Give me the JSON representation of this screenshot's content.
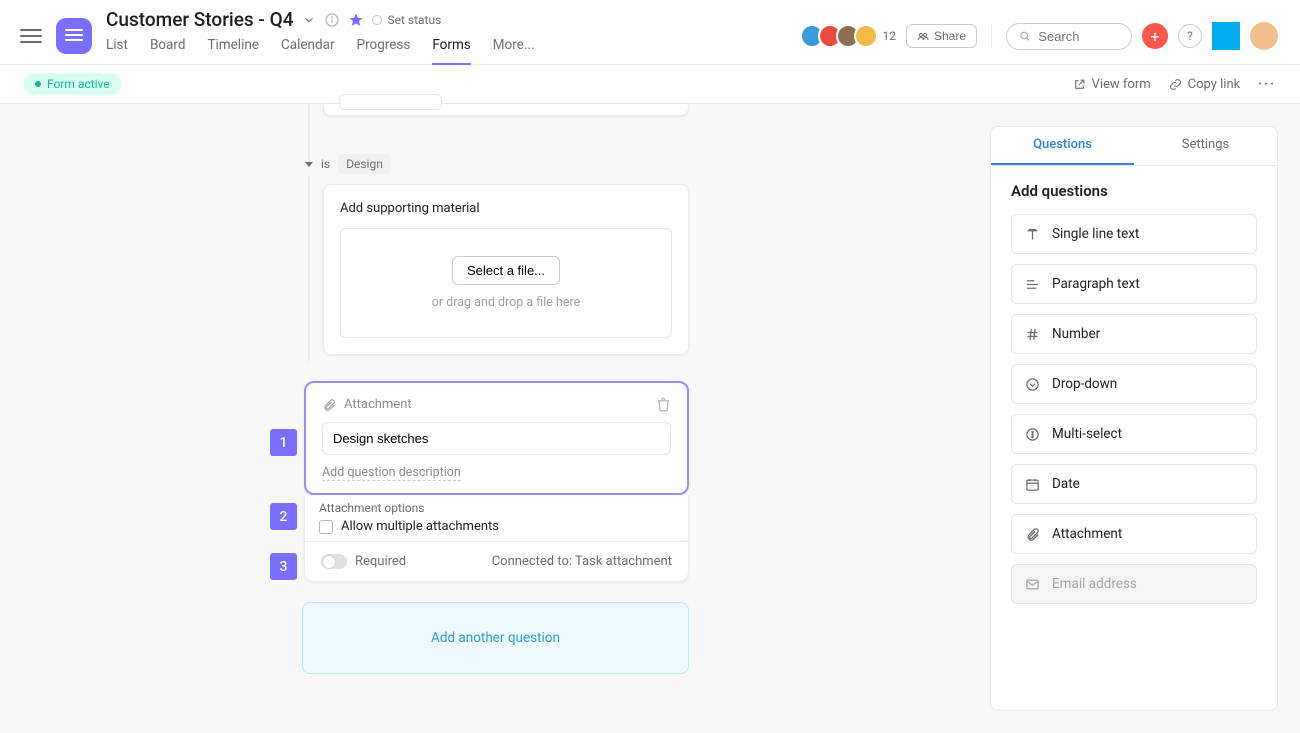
{
  "header": {
    "title": "Customer Stories - Q4",
    "set_status": "Set status",
    "tabs": [
      "List",
      "Board",
      "Timeline",
      "Calendar",
      "Progress",
      "Forms",
      "More..."
    ],
    "active_tab_index": 5,
    "avatar_overflow": "12",
    "share": "Share",
    "search_placeholder": "Search"
  },
  "subbar": {
    "form_badge": "Form active",
    "view_form": "View form",
    "copy_link": "Copy link"
  },
  "branch": {
    "is": "is",
    "value": "Design"
  },
  "supporting": {
    "title": "Add supporting material",
    "select_file": "Select a file...",
    "hint": "or drag and drop a file here"
  },
  "steps": [
    "1",
    "2",
    "3"
  ],
  "question": {
    "type_label": "Attachment",
    "title_value": "Design sketches",
    "add_description": "Add question description",
    "options_title": "Attachment options",
    "allow_multiple": "Allow multiple attachments",
    "required": "Required",
    "connected": "Connected to: Task attachment"
  },
  "add_another": "Add another question",
  "sidepanel": {
    "tabs": [
      "Questions",
      "Settings"
    ],
    "active_tab_index": 0,
    "title": "Add questions",
    "types": [
      {
        "label": "Single line text",
        "icon": "text"
      },
      {
        "label": "Paragraph text",
        "icon": "paragraph"
      },
      {
        "label": "Number",
        "icon": "number"
      },
      {
        "label": "Drop-down",
        "icon": "dropdown"
      },
      {
        "label": "Multi-select",
        "icon": "multiselect"
      },
      {
        "label": "Date",
        "icon": "date"
      },
      {
        "label": "Attachment",
        "icon": "attachment"
      },
      {
        "label": "Email address",
        "icon": "email",
        "disabled": true
      }
    ]
  }
}
